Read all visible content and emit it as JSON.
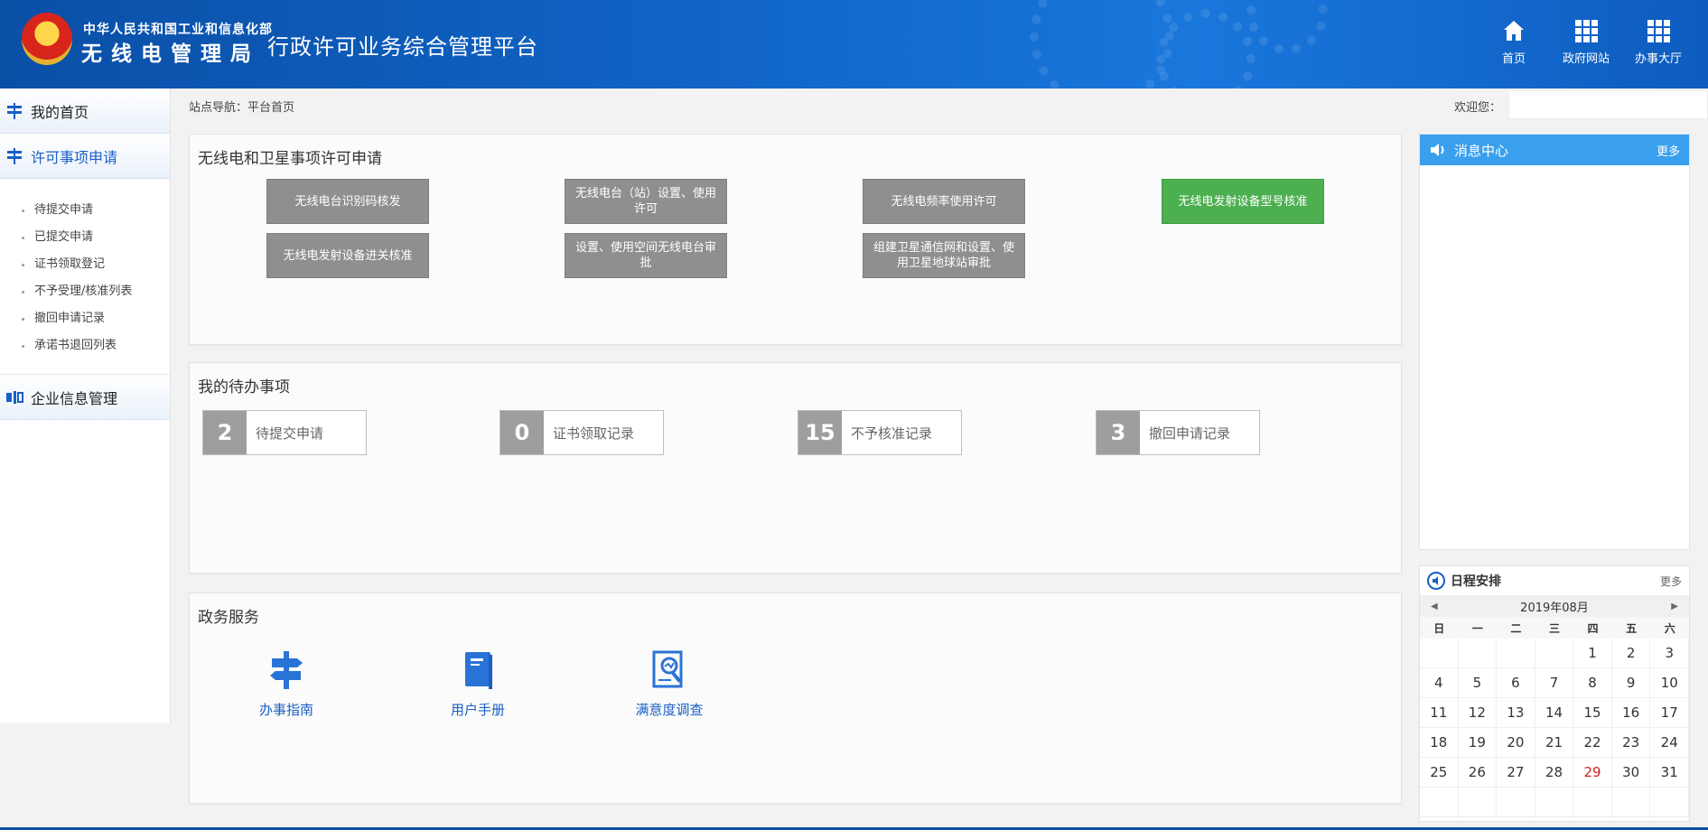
{
  "header": {
    "org_small": "中华人民共和国工业和信息化部",
    "org_big": "无线电管理局",
    "platform_title": "行政许可业务综合管理平台",
    "nav": [
      {
        "label": "首页",
        "icon": "home-icon"
      },
      {
        "label": "政府网站",
        "icon": "grid-icon"
      },
      {
        "label": "办事大厅",
        "icon": "grid-icon"
      }
    ]
  },
  "sidebar": {
    "home": "我的首页",
    "permit": "许可事项申请",
    "permit_items": [
      "待提交申请",
      "已提交申请",
      "证书领取登记",
      "不予受理/核准列表",
      "撤回申请记录",
      "承诺书退回列表"
    ],
    "enterprise": "企业信息管理"
  },
  "breadcrumb": "站点导航：平台首页",
  "welcome": "欢迎您：",
  "permit_panel": {
    "title": "无线电和卫星事项许可申请",
    "buttons": [
      "无线电台识别码核发",
      "无线电台（站）设置、使用许可",
      "无线电频率使用许可",
      "无线电发射设备型号核准",
      "无线电发射设备进关核准",
      "设置、使用空间无线电台审批",
      "组建卫星通信网和设置、使用卫星地球站审批"
    ]
  },
  "todo_panel": {
    "title": "我的待办事项",
    "items": [
      {
        "count": "2",
        "label": "待提交申请"
      },
      {
        "count": "0",
        "label": "证书领取记录"
      },
      {
        "count": "15",
        "label": "不予核准记录"
      },
      {
        "count": "3",
        "label": "撤回申请记录"
      }
    ]
  },
  "service_panel": {
    "title": "政务服务",
    "items": [
      "办事指南",
      "用户手册",
      "满意度调查"
    ]
  },
  "message_center": {
    "title": "消息中心",
    "more": "更多"
  },
  "schedule": {
    "title": "日程安排",
    "more": "更多",
    "month": "2019年08月",
    "weekdays": [
      "日",
      "一",
      "二",
      "三",
      "四",
      "五",
      "六"
    ],
    "days": [
      "",
      "",
      "",
      "",
      "1",
      "2",
      "3",
      "4",
      "5",
      "6",
      "7",
      "8",
      "9",
      "10",
      "11",
      "12",
      "13",
      "14",
      "15",
      "16",
      "17",
      "18",
      "19",
      "20",
      "21",
      "22",
      "23",
      "24",
      "25",
      "26",
      "27",
      "28",
      "29",
      "30",
      "31",
      "",
      "",
      "",
      "",
      "",
      "",
      ""
    ],
    "today": "29",
    "today_color": "#d42020"
  },
  "colors": {
    "header_blue": "#1166c9",
    "accent_green": "#4caf50",
    "button_gray": "#8f8f8f",
    "link_blue": "#1a5fc5",
    "message_blue": "#3aa0ee"
  }
}
